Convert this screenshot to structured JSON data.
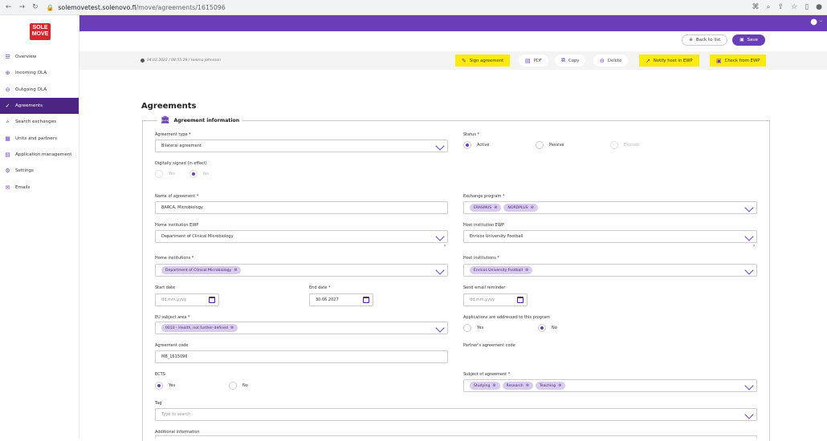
{
  "browser": {
    "url_host": "solemovetest.solenovo.fi",
    "url_path": "/move/agreements/1615096"
  },
  "brand": {
    "logo_line1": "SOLE",
    "logo_line2": "MOVE"
  },
  "sidebar": {
    "items": [
      {
        "label": "Overview",
        "icon": "overview-icon",
        "glyph": "☰"
      },
      {
        "label": "Incoming OLA",
        "icon": "incoming-icon",
        "glyph": "⊕"
      },
      {
        "label": "Outgoing OLA",
        "icon": "outgoing-icon",
        "glyph": "⊖"
      },
      {
        "label": "Agreements",
        "icon": "check-circle-icon",
        "glyph": "✓",
        "active": true
      },
      {
        "label": "Search exchanges",
        "icon": "search-icon",
        "glyph": "⌕"
      },
      {
        "label": "Units and partners",
        "icon": "building-icon",
        "glyph": "▦"
      },
      {
        "label": "Application management",
        "icon": "document-icon",
        "glyph": "▤"
      },
      {
        "label": "Settings",
        "icon": "gear-icon",
        "glyph": "⚙"
      },
      {
        "label": "Emails",
        "icon": "mail-icon",
        "glyph": "✉"
      }
    ]
  },
  "header": {
    "back_label": "Back to list",
    "save_label": "Save"
  },
  "toolbar": {
    "meta": "04.02.2022 / 08:55:28 / Helena Johnsson",
    "sign": "Sign agreement",
    "pdf": "PDF",
    "copy": "Copy",
    "delete": "Delete",
    "notify": "Notify host in EWP",
    "check": "Check from EWP"
  },
  "page_title": "Agreements",
  "section_title": "Agreement information",
  "form": {
    "agreement_type_label": "Agreement type *",
    "agreement_type_value": "Bilateral agreement",
    "status_label": "Status *",
    "status_options": [
      "Active",
      "Passive",
      "Expired"
    ],
    "digital_label": "Digitally signed (in effect)",
    "digital_options": [
      "Yes",
      "No"
    ],
    "name_label": "Name of agreement *",
    "name_value": "BARCA, Microbiology",
    "exchange_label": "Exchange program *",
    "exchange_chips": [
      "ERASMUS",
      "NORDPLUS"
    ],
    "home_ewp_label": "Home institution EWP",
    "home_ewp_value": "Department of Clinical Microbiology",
    "host_ewp_label": "Host institution EWP",
    "host_ewp_value": "Enricos University Football",
    "home_inst_label": "Home institutions *",
    "home_inst_chip": "Department of Clinical Microbiology",
    "host_inst_label": "Host institutions *",
    "host_inst_chip": "Enricos University Football",
    "start_label": "Start date",
    "start_placeholder": "dd.mm.yyyy",
    "end_label": "End date *",
    "end_value": "30.06.2027",
    "reminder_label": "Send email reminder",
    "reminder_placeholder": "dd.mm.yyyy",
    "eu_label": "EU subject area *",
    "eu_chip": "0010 - Health, not further defined",
    "apps_label": "Applications are addressed to this program",
    "apps_options": [
      "Yes",
      "No"
    ],
    "code_label": "Agreement code",
    "code_value": "MB_1615096",
    "partner_code_label": "Partner's agreement code",
    "ects_label": "ECTS",
    "ects_options": [
      "Yes",
      "No"
    ],
    "subject_label": "Subject of agreement *",
    "subject_chips": [
      "Studying",
      "Research",
      "Teaching"
    ],
    "tag_label": "Tag",
    "tag_placeholder": "Type to search",
    "additional_label": "Additional information"
  },
  "colors": {
    "brand_purple": "#6a3fb5",
    "active_nav": "#4b2581",
    "highlight": "#ffeb0a",
    "logo_red": "#d8262f"
  }
}
